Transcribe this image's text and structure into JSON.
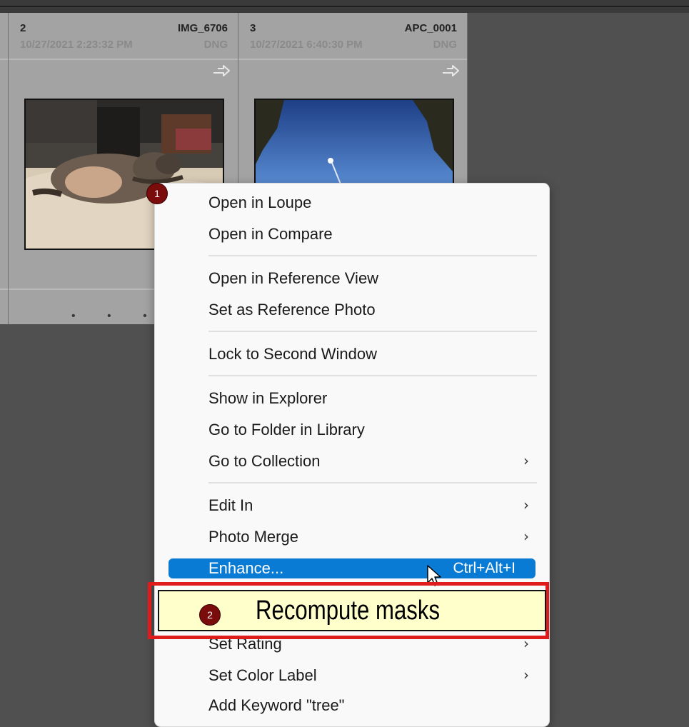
{
  "grid": {
    "cells": [
      {
        "number": "2",
        "name": "IMG_6706",
        "date": "10/27/2021 2:23:32 PM",
        "type": "DNG",
        "thumbnail": "cat-sleeping-photo"
      },
      {
        "number": "3",
        "name": "APC_0001",
        "date": "10/27/2021 6:40:30 PM",
        "type": "DNG",
        "thumbnail": "sky-trees-photo"
      }
    ],
    "dots": "• • • •"
  },
  "context_menu": {
    "items": [
      {
        "label": "Open in Loupe"
      },
      {
        "label": "Open in Compare"
      },
      {
        "label": "Open in Reference View"
      },
      {
        "label": "Set as Reference Photo"
      },
      {
        "label": "Lock to Second Window"
      },
      {
        "label": "Show in Explorer"
      },
      {
        "label": "Go to Folder in Library"
      },
      {
        "label": "Go to Collection",
        "submenu": "›"
      },
      {
        "label": "Edit In",
        "submenu": "›"
      },
      {
        "label": "Photo Merge",
        "submenu": "›"
      },
      {
        "label": "Enhance...",
        "shortcut": "Ctrl+Alt+I",
        "highlighted": true
      },
      {
        "label": "Set Rating",
        "submenu": "›"
      },
      {
        "label": "Set Color Label",
        "submenu": "›"
      },
      {
        "label": "Add Keyword \"tree\""
      }
    ]
  },
  "annotations": {
    "badge1": "1",
    "badge2": "2",
    "callout_text": "Recompute masks",
    "callout_color": "#e01b1b",
    "callout_bg": "#ffffcc"
  },
  "colors": {
    "highlight": "#0a7bd4",
    "badge": "#7a0c0c"
  }
}
